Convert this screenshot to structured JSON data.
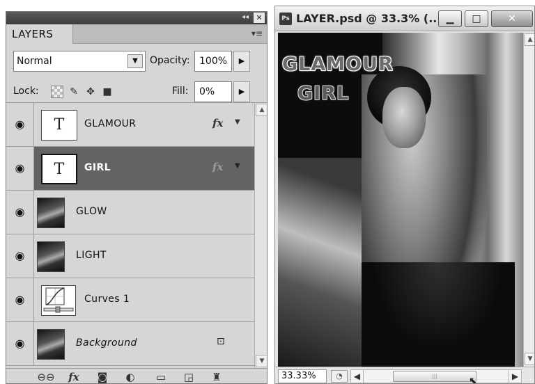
{
  "layers_panel": {
    "tab_label": "LAYERS",
    "collapse_glyph": "◂◂",
    "close_glyph": "✕",
    "menu_glyph": "▾≡",
    "blend_mode": "Normal",
    "opacity_label": "Opacity:",
    "opacity_value": "100%",
    "lock_label": "Lock:",
    "fill_label": "Fill:",
    "fill_value": "0%",
    "layers": [
      {
        "name": "GLAMOUR",
        "type": "text",
        "thumb_glyph": "T",
        "has_fx": true,
        "selected": false
      },
      {
        "name": "GIRL",
        "type": "text",
        "thumb_glyph": "T",
        "has_fx": true,
        "selected": true
      },
      {
        "name": "GLOW",
        "type": "image",
        "has_fx": false,
        "selected": false
      },
      {
        "name": "LIGHT",
        "type": "image",
        "has_fx": false,
        "selected": false
      },
      {
        "name": "Curves 1",
        "type": "adjustment",
        "has_fx": false,
        "selected": false
      },
      {
        "name": "Background",
        "type": "image",
        "has_fx": false,
        "locked": true,
        "selected": false
      }
    ],
    "fx_glyph": "fx",
    "footer_icons": [
      "link-icon",
      "fx-icon",
      "mask-icon",
      "adjustment-icon",
      "folder-icon",
      "new-layer-icon",
      "trash-icon"
    ]
  },
  "document": {
    "title": "LAYER.psd @ 33.3% (...",
    "app_badge": "Ps",
    "art_text_line1": "GLAMOUR",
    "art_text_line2": "GIRL",
    "zoom": "33.33%",
    "colors": {
      "selected_row": "#636363",
      "panel_bg": "#d6d6d6"
    }
  }
}
